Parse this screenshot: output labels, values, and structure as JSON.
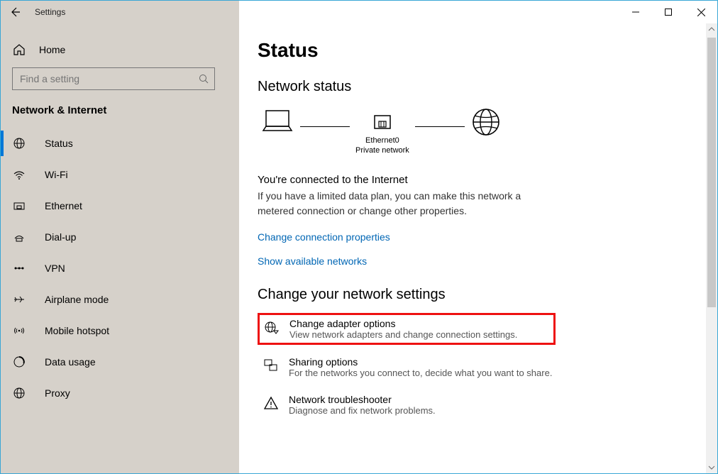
{
  "window": {
    "title": "Settings"
  },
  "sidebar": {
    "home": "Home",
    "search_placeholder": "Find a setting",
    "category": "Network & Internet",
    "items": [
      {
        "label": "Status"
      },
      {
        "label": "Wi-Fi"
      },
      {
        "label": "Ethernet"
      },
      {
        "label": "Dial-up"
      },
      {
        "label": "VPN"
      },
      {
        "label": "Airplane mode"
      },
      {
        "label": "Mobile hotspot"
      },
      {
        "label": "Data usage"
      },
      {
        "label": "Proxy"
      }
    ]
  },
  "main": {
    "page_title": "Status",
    "section_network_status": "Network status",
    "diagram": {
      "adapter_name": "Ethernet0",
      "network_type": "Private network"
    },
    "connected_headline": "You're connected to the Internet",
    "connected_desc": "If you have a limited data plan, you can make this network a metered connection or change other properties.",
    "link_change_props": "Change connection properties",
    "link_show_networks": "Show available networks",
    "section_change_settings": "Change your network settings",
    "options": [
      {
        "title": "Change adapter options",
        "desc": "View network adapters and change connection settings."
      },
      {
        "title": "Sharing options",
        "desc": "For the networks you connect to, decide what you want to share."
      },
      {
        "title": "Network troubleshooter",
        "desc": "Diagnose and fix network problems."
      }
    ]
  }
}
